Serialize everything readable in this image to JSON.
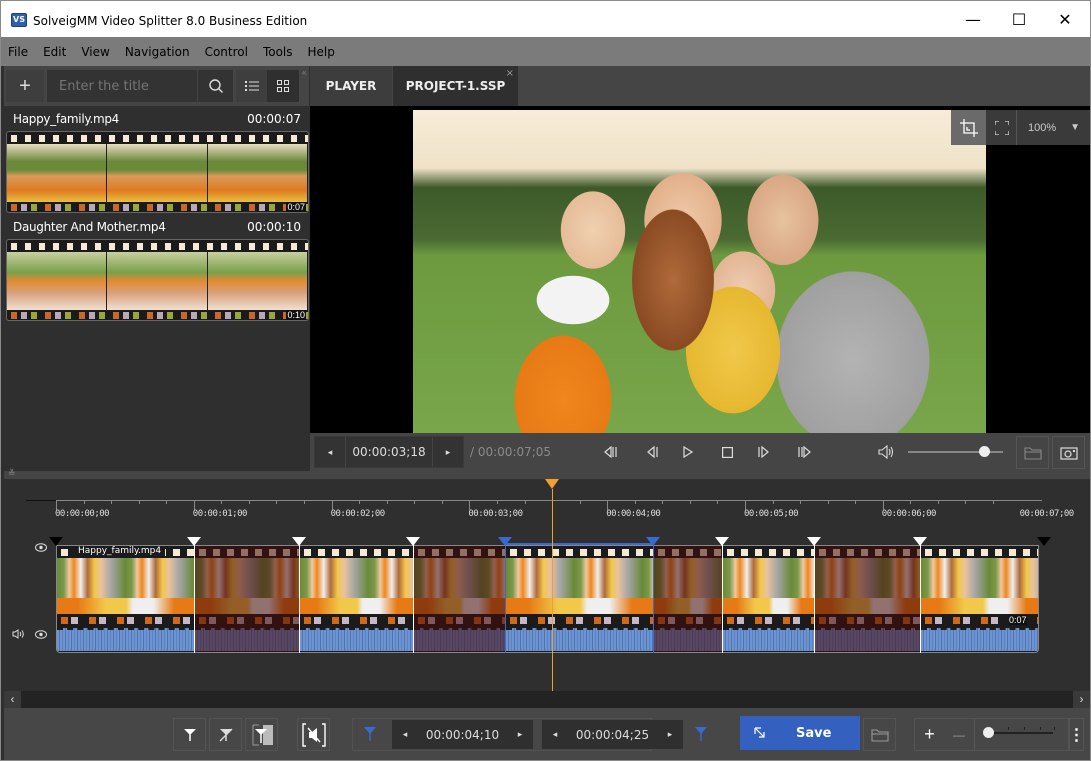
{
  "window": {
    "title": "SolveigMM Video Splitter 8.0 Business Edition",
    "logo_text": "VS",
    "minimize": "—",
    "maximize": "☐",
    "close": "✕"
  },
  "menu": [
    "File",
    "Edit",
    "View",
    "Navigation",
    "Control",
    "Tools",
    "Help"
  ],
  "library": {
    "add_icon": "+",
    "search_placeholder": "Enter the title",
    "search_icon": "⚲",
    "list_view_icon": "☰",
    "grid_view_icon": "▦",
    "collapse_icon": "«",
    "files": [
      {
        "name": "Happy_family.mp4",
        "duration": "00:00:07",
        "strip_duration": "0:07"
      },
      {
        "name": "Daughter And Mother.mp4",
        "duration": "00:00:10",
        "strip_duration": "0:10"
      }
    ]
  },
  "tabs": [
    {
      "label": "PLAYER",
      "active": false
    },
    {
      "label": "PROJECT-1.SSP",
      "active": true,
      "close": "×"
    }
  ],
  "preview": {
    "zoom_level": "100%",
    "zoom_dropdown": "▼"
  },
  "transport": {
    "current_time": "00:00:03;18",
    "total_time": "/ 00:00:07;05",
    "prev_arrow": "◂",
    "next_arrow": "▸",
    "volume_fraction": 0.8
  },
  "timeline": {
    "collapse_icon": "≚",
    "ticks": [
      "00:00:00;00",
      "00:00:01;00",
      "00:00:02;00",
      "00:00:03;00",
      "00:00:04;00",
      "00:00:05;00",
      "00:00:06;00",
      "00:00:07;00"
    ],
    "playhead_seconds": 3.6,
    "duration_seconds": 7.17,
    "track_name": "Happy_family.mp4",
    "track_duration": "0:07",
    "segments": [
      {
        "start": 0.0,
        "end": 1.0,
        "state": "keep"
      },
      {
        "start": 1.0,
        "end": 1.76,
        "state": "cut"
      },
      {
        "start": 1.76,
        "end": 2.59,
        "state": "keep"
      },
      {
        "start": 2.59,
        "end": 3.26,
        "state": "cut"
      },
      {
        "start": 3.26,
        "end": 4.33,
        "state": "selected"
      },
      {
        "start": 4.33,
        "end": 4.83,
        "state": "cut"
      },
      {
        "start": 4.83,
        "end": 5.5,
        "state": "keep"
      },
      {
        "start": 5.5,
        "end": 6.27,
        "state": "cut"
      },
      {
        "start": 6.27,
        "end": 7.17,
        "state": "keep"
      }
    ],
    "scroll_left": "‹",
    "scroll_right": "›"
  },
  "bottom": {
    "marker_in_time": "00:00:04;10",
    "marker_out_time": "00:00:04;25",
    "save_label": "Save",
    "zoom_in": "+",
    "zoom_out": "—",
    "more": "⋮"
  },
  "colors": {
    "accent_blue": "#3460c0",
    "playhead_orange": "#f0a030",
    "waveform_blue": "#6a94d6"
  }
}
